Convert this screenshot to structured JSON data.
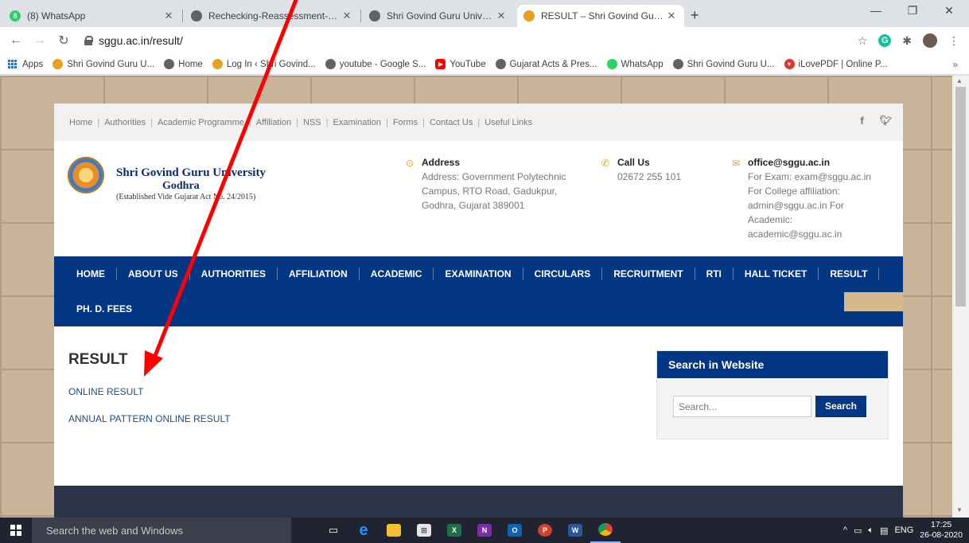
{
  "browser": {
    "tabs": [
      {
        "label": "(8) WhatsApp",
        "icon": "whatsapp-icon",
        "color": "#25d366",
        "badge": "8"
      },
      {
        "label": "Rechecking-Reassessment-Online",
        "icon": "globe-icon",
        "color": "#5f6368"
      },
      {
        "label": "Shri Govind Guru University Godh",
        "icon": "globe-icon",
        "color": "#5f6368"
      },
      {
        "label": "RESULT – Shri Govind Guru Unive",
        "icon": "sggu-icon",
        "color": "#e8a020"
      }
    ],
    "url": "sggu.ac.in/result/",
    "bookmarks": [
      {
        "label": "Apps"
      },
      {
        "label": "Shri Govind Guru U...",
        "color": "#e8a020"
      },
      {
        "label": "Home",
        "color": "#5f6368"
      },
      {
        "label": "Log In ‹ Shri Govind...",
        "color": "#e8a020"
      },
      {
        "label": "youtube - Google S...",
        "color": "#5f6368"
      },
      {
        "label": "YouTube",
        "color": "#ff0000"
      },
      {
        "label": "Gujarat Acts & Pres...",
        "color": "#5f6368"
      },
      {
        "label": "WhatsApp",
        "color": "#25d366"
      },
      {
        "label": "Shri Govind Guru U...",
        "color": "#5f6368"
      },
      {
        "label": "iLovePDF | Online P...",
        "color": "#e5322d"
      }
    ],
    "bookmarks_more": "»"
  },
  "site": {
    "topnav": [
      "Home",
      "Authorities",
      "Academic Programme",
      "Affiliation",
      "NSS",
      "Examination",
      "Forms",
      "Contact Us",
      "Useful Links"
    ],
    "social": {
      "facebook": "f",
      "twitter": "t"
    },
    "logo": {
      "name": "Shri Govind Guru University",
      "city": "Godhra",
      "established": "(Established Vide Gujarat Act No. 24/2015)"
    },
    "address": {
      "title": "Address",
      "lines": [
        "Address: Government Polytechnic",
        "Campus, RTO Road, Gadukpur,",
        "Godhra, Gujarat 389001"
      ]
    },
    "call": {
      "title": "Call Us",
      "phone": "02672 255 101"
    },
    "email": {
      "title": "office@sggu.ac.in",
      "lines": [
        "For Exam: exam@sggu.ac.in",
        "For College affiliation:",
        "admin@sggu.ac.in For",
        "Academic:",
        "academic@sggu.ac.in"
      ]
    },
    "mainnav_row1": [
      "HOME",
      "ABOUT US",
      "AUTHORITIES",
      "AFFILIATION",
      "ACADEMIC",
      "EXAMINATION",
      "CIRCULARS",
      "RECRUITMENT",
      "RTI",
      "HALL TICKET",
      "RESULT"
    ],
    "mainnav_row2": [
      "PH. D. FEES"
    ],
    "page_title": "RESULT",
    "links": [
      "ONLINE RESULT",
      "ANNUAL PATTERN ONLINE RESULT"
    ],
    "sidebar": {
      "title": "Search in Website",
      "placeholder": "Search...",
      "button": "Search"
    }
  },
  "taskbar": {
    "search_placeholder": "Search the web and Windows",
    "language": "ENG",
    "time": "17:25",
    "date": "26-08-2020"
  },
  "colors": {
    "nav_blue": "#033784",
    "accent_tan": "#d5b98b",
    "arrow_red": "#ff0000"
  }
}
